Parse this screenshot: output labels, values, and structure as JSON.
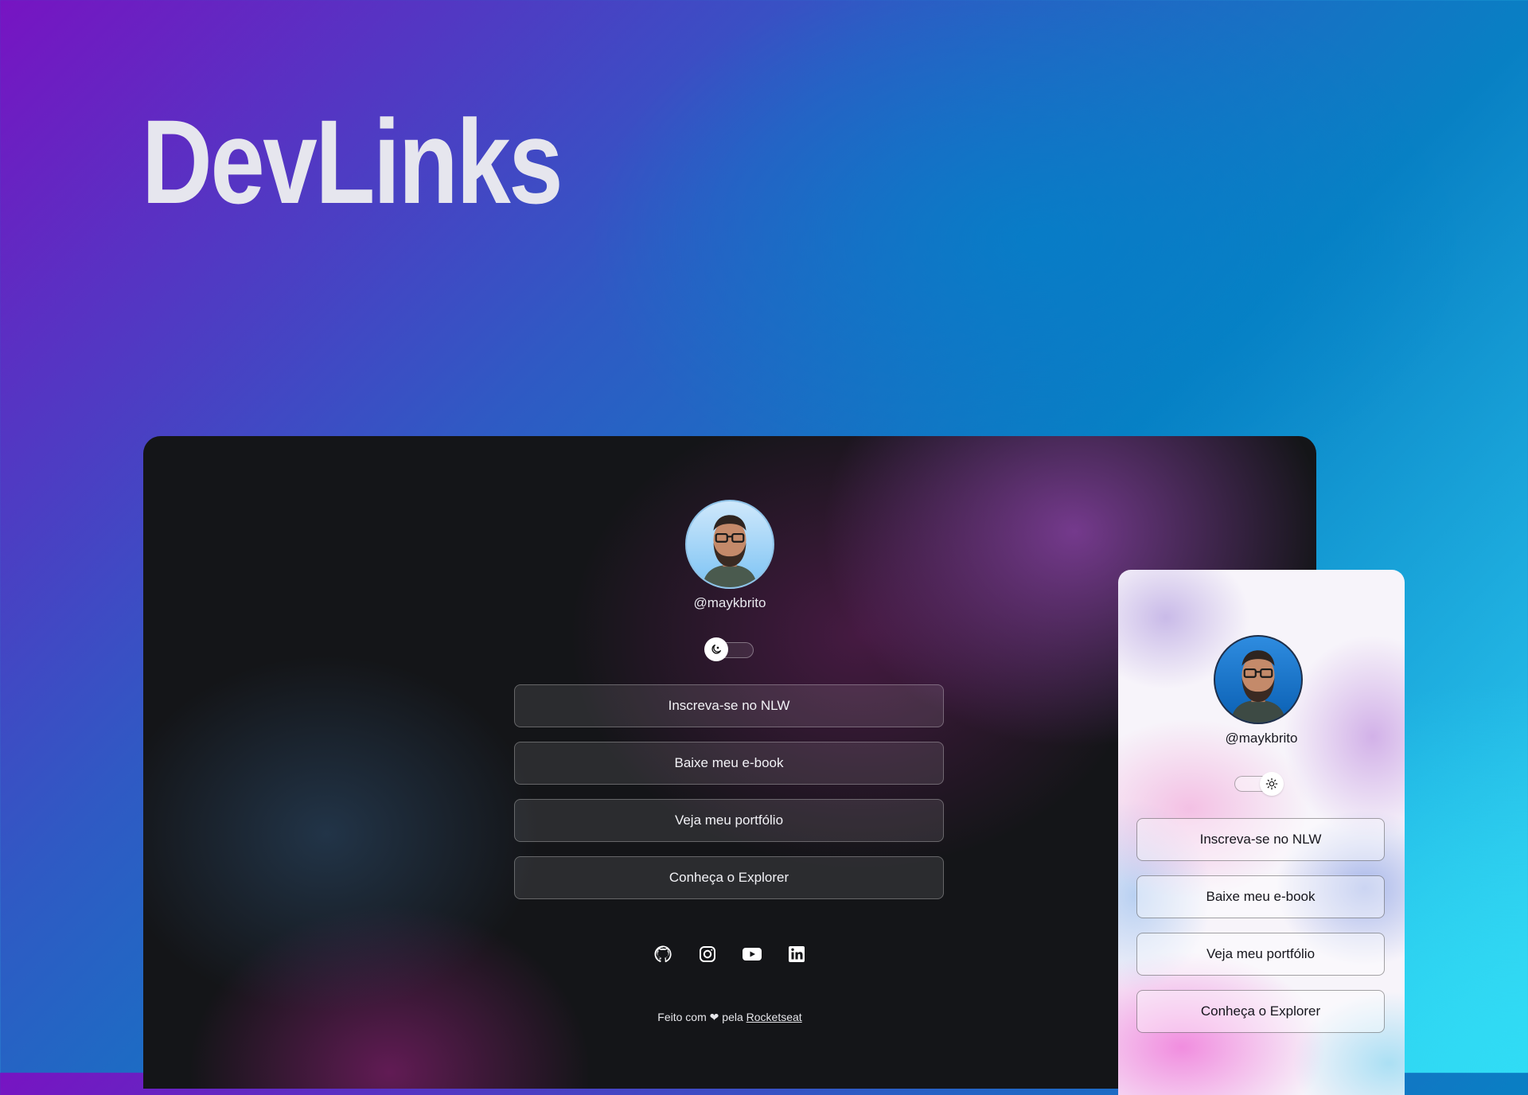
{
  "brand": {
    "title": "DevLinks"
  },
  "desktop": {
    "username": "@maykbrito",
    "links": [
      {
        "label": "Inscreva-se no NLW"
      },
      {
        "label": "Baixe meu e-book"
      },
      {
        "label": "Veja meu portfólio"
      },
      {
        "label": "Conheça o Explorer"
      }
    ],
    "social_icons": [
      "github-icon",
      "instagram-icon",
      "youtube-icon",
      "linkedin-icon"
    ],
    "footer": {
      "prefix": "Feito com",
      "middle": "pela",
      "link": "Rocketseat"
    },
    "theme_toggle": {
      "mode": "dark",
      "icon": "moon-icon"
    }
  },
  "mobile": {
    "username": "@maykbrito",
    "links": [
      {
        "label": "Inscreva-se no NLW"
      },
      {
        "label": "Baixe meu e-book"
      },
      {
        "label": "Veja meu portfólio"
      },
      {
        "label": "Conheça o Explorer"
      }
    ],
    "theme_toggle": {
      "mode": "light",
      "icon": "sun-icon"
    }
  },
  "colors": {
    "background_start": "#7714c2",
    "background_end": "#35d6f2",
    "dark_panel": "#141518",
    "heading": "#e6e6ee"
  }
}
